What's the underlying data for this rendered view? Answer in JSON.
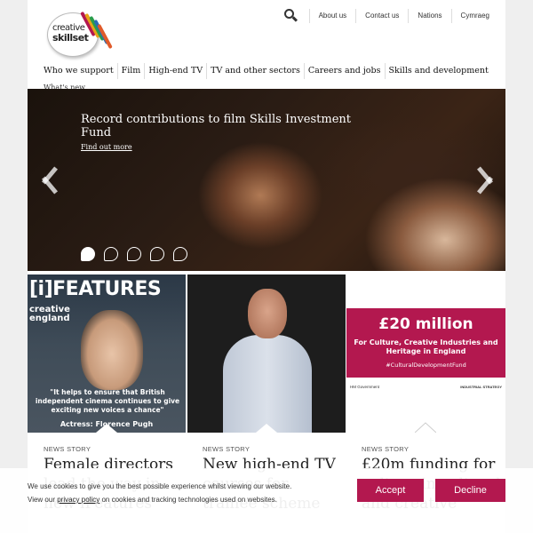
{
  "logo": {
    "line1": "creative",
    "line2": "skillset",
    "stripe_colors": [
      "#b3184f",
      "#e8a317",
      "#2a9d4b",
      "#2b6cb0",
      "#e05a2a"
    ]
  },
  "utility_nav": [
    "About us",
    "Contact us",
    "Nations",
    "Cymraeg"
  ],
  "main_nav": [
    "Who we support",
    "Film",
    "High-end TV",
    "TV and other sectors",
    "Careers and jobs",
    "Skills and development"
  ],
  "main_nav_more": "What's new",
  "hero": {
    "title": "Record contributions to film Skills Investment Fund",
    "link": "Find out more",
    "slides": 5,
    "active_slide": 1
  },
  "cards": [
    {
      "image": {
        "brand": "[i]FEATURES",
        "sub1": "creative",
        "sub2": "england",
        "quote": "\"It helps to ensure that British independent cinema continues to give exciting new voices a chance\"",
        "credit": "Actress: Florence Pugh"
      },
      "label": "NEWS STORY",
      "title": "Female directors lead the way in new iFeatures"
    },
    {
      "label": "NEWS STORY",
      "title": "New high-end TV courses for trainee scheme"
    },
    {
      "image": {
        "amount": "£20 million",
        "subtitle": "For Culture, Creative Industries and Heritage in England",
        "hashtag": "#CulturalDevelopmentFund",
        "gov": "HM Government",
        "ind": "INDUSTRIAL STRATEGY"
      },
      "label": "NEWS STORY",
      "title": "£20m funding for culture in cultural and creative"
    }
  ],
  "cookie": {
    "text_before": "We use cookies to give you the best possible experience whilst viewing our website. View our ",
    "link": "privacy policy",
    "text_after": " on cookies and tracking technologies used on websites.",
    "accept": "Accept",
    "decline": "Decline"
  },
  "colors": {
    "brand": "#b3184f",
    "background": "#efefef"
  }
}
